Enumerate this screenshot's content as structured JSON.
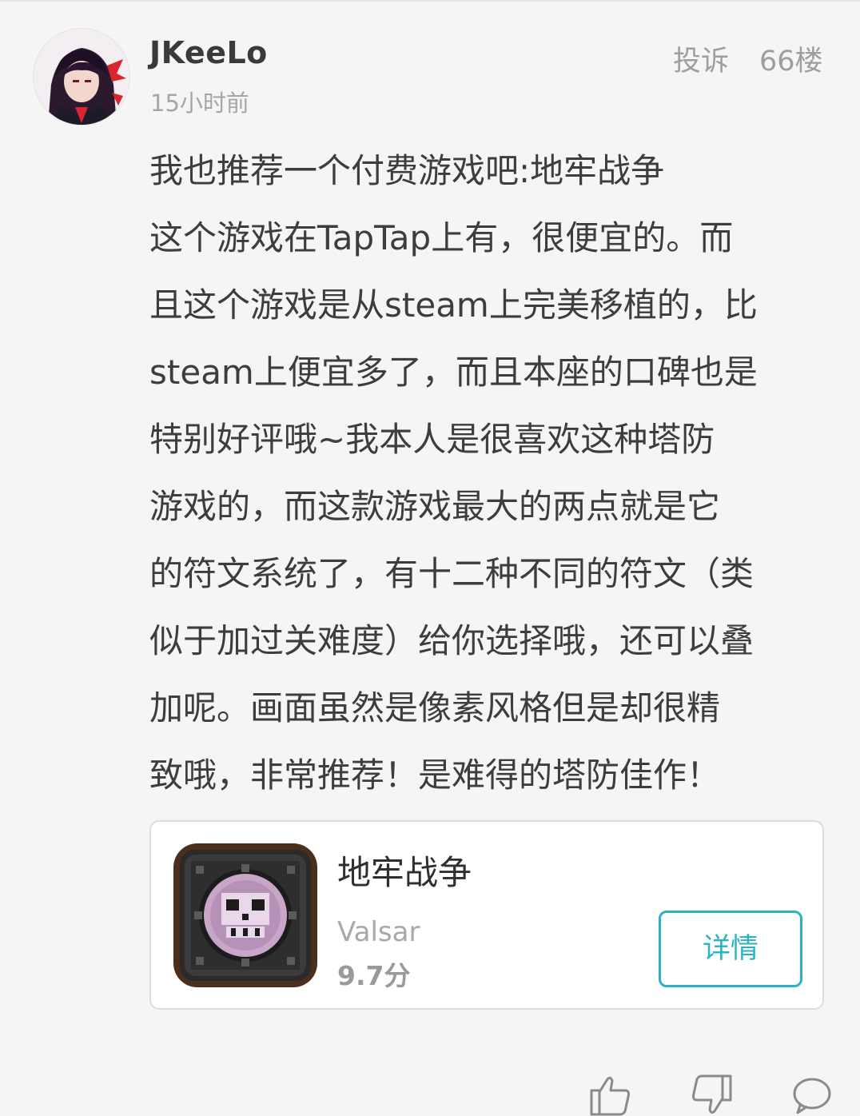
{
  "comment": {
    "username": "JKeeLo",
    "time": "15小时前",
    "report_label": "投诉",
    "floor": "66楼",
    "body_lines": [
      "我也推荐一个付费游戏吧:地牢战争",
      "这个游戏在TapTap上有，很便宜的。而",
      "且这个游戏是从steam上完美移植的，比",
      "steam上便宜多了，而且本座的口碑也是",
      "特别好评哦~我本人是很喜欢这种塔防",
      "游戏的，而这款游戏最大的两点就是它",
      "的符文系统了，有十二种不同的符文（类",
      "似于加过关难度）给你选择哦，还可以叠",
      "加呢。画面虽然是像素风格但是却很精",
      "致哦，非常推荐！是难得的塔防佳作！"
    ]
  },
  "app_card": {
    "name": "地牢战争",
    "developer": "Valsar",
    "score": "9.7分",
    "detail_button": "详情",
    "accent_color": "#29b3c5"
  },
  "actions": {
    "icons": [
      "thumbs-up-icon",
      "thumbs-down-icon",
      "comment-icon"
    ]
  }
}
